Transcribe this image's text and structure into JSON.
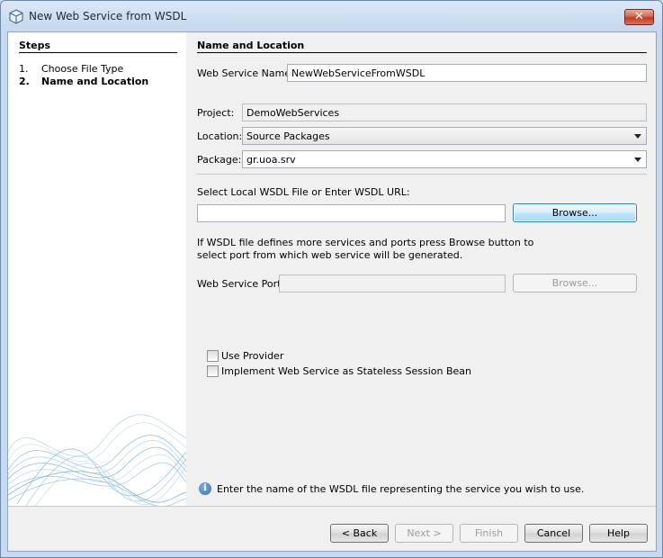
{
  "window": {
    "title": "New Web Service from WSDL",
    "close_glyph": "✕"
  },
  "steps": {
    "heading": "Steps",
    "items": [
      {
        "num": "1.",
        "label": "Choose File Type"
      },
      {
        "num": "2.",
        "label": "Name and Location"
      }
    ]
  },
  "section": {
    "title": "Name and Location"
  },
  "form": {
    "service_name_label": "Web Service Name:",
    "service_name_value": "NewWebServiceFromWSDL",
    "project_label": "Project:",
    "project_value": "DemoWebServices",
    "location_label": "Location:",
    "location_value": "Source Packages",
    "package_label": "Package:",
    "package_value": "gr.uoa.srv",
    "wsdl_label": "Select Local WSDL File or Enter WSDL URL:",
    "wsdl_value": "",
    "browse_label": "Browse...",
    "hint_line1": "If WSDL file defines more services and ports press Browse button to",
    "hint_line2": "select port from which web service will be generated.",
    "port_label": "Web Service Port:",
    "port_value": "",
    "port_browse_label": "Browse...",
    "use_provider_label": "Use Provider",
    "stateless_label": "Implement Web Service as Stateless Session Bean"
  },
  "info": {
    "message": "Enter the name of the WSDL file representing the service you wish to use."
  },
  "buttons": {
    "back": "< Back",
    "next": "Next >",
    "finish": "Finish",
    "cancel": "Cancel",
    "help": "Help"
  },
  "colors": {
    "accent": "#3c7fb1",
    "close": "#c23b20"
  }
}
